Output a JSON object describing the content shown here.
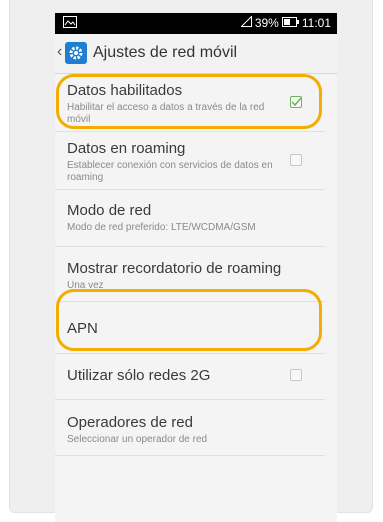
{
  "statusbar": {
    "battery": "39%",
    "time": "11:01"
  },
  "actionbar": {
    "title": "Ajustes de red móvil"
  },
  "settings": [
    {
      "title": "Datos habilitados",
      "subtitle": "Habilitar el acceso a datos a través de la red móvil",
      "checkbox": true,
      "checked": true
    },
    {
      "title": "Datos en roaming",
      "subtitle": "Establecer conexión con servicios de datos en roaming",
      "checkbox": true,
      "checked": false
    },
    {
      "title": "Modo de red",
      "subtitle": "Modo de red preferido: LTE/WCDMA/GSM"
    },
    {
      "title": "Mostrar recordatorio de roaming",
      "subtitle": "Una vez"
    },
    {
      "title": "APN"
    },
    {
      "title": "Utilizar sólo redes 2G",
      "checkbox": true,
      "checked": false
    },
    {
      "title": "Operadores de red",
      "subtitle": "Seleccionar un operador de red"
    }
  ],
  "colors": {
    "highlight": "#f2ad00",
    "accent": "#1e7fd0",
    "check": "#6fb25c"
  }
}
